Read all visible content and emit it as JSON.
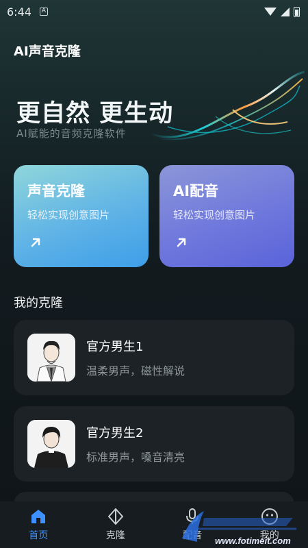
{
  "status_bar": {
    "time": "6:44",
    "app_badge": "A"
  },
  "header": {
    "title": "AI声音克隆"
  },
  "hero": {
    "title": "更自然 更生动",
    "subtitle": "AI赋能的音频克隆软件"
  },
  "feature_cards": [
    {
      "title": "声音克隆",
      "subtitle": "轻松实现创意图片"
    },
    {
      "title": "AI配音",
      "subtitle": "轻松实现创意图片"
    }
  ],
  "my_clones": {
    "section_title": "我的克隆",
    "items": [
      {
        "name": "官方男生1",
        "description": "温柔男声，磁性解说"
      },
      {
        "name": "官方男生2",
        "description": "标准男声，嗓音清亮"
      }
    ]
  },
  "bottom_nav": {
    "items": [
      {
        "label": "首页",
        "icon": "home-icon",
        "active": true
      },
      {
        "label": "克隆",
        "icon": "diamond-icon",
        "active": false
      },
      {
        "label": "配音",
        "icon": "mic-icon",
        "active": false
      },
      {
        "label": "我的",
        "icon": "face-icon",
        "active": false
      }
    ]
  },
  "watermark": {
    "text": "www.fotimeit.com"
  },
  "colors": {
    "accent": "#3f90ff",
    "card_clone": "#5fb3e6",
    "card_dub": "#6f78dc",
    "background": "#0f1418"
  }
}
